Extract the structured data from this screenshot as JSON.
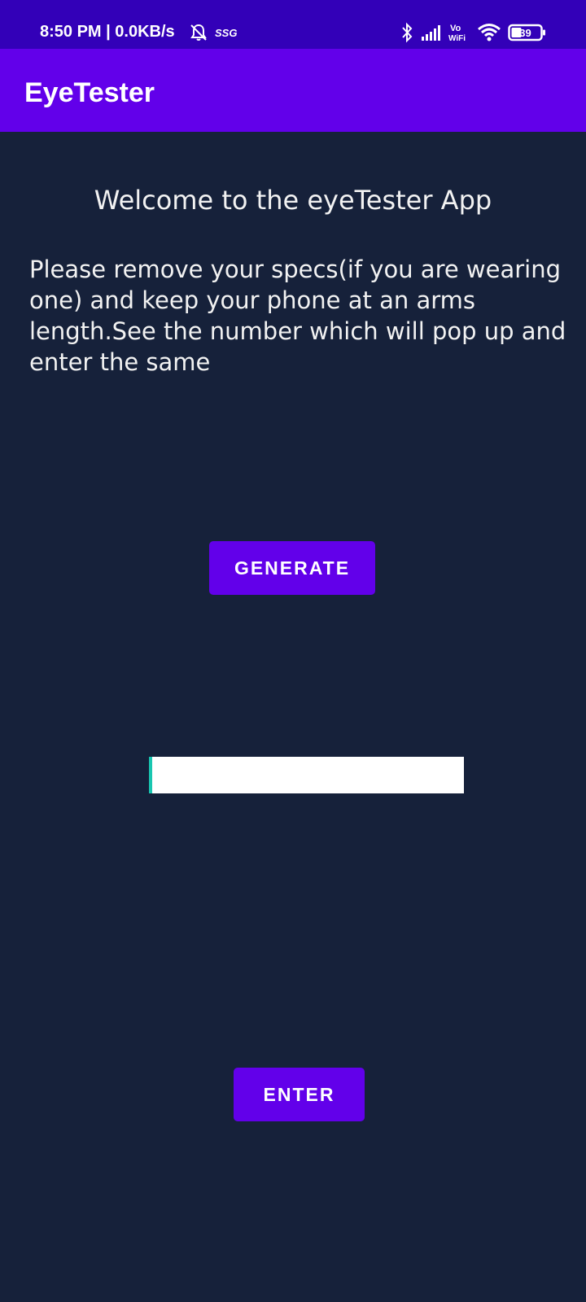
{
  "status_bar": {
    "time_and_speed": "8:50 PM | 0.0KB/s",
    "carrier_tag": "SSG",
    "vowifi_top": "Vo",
    "vowifi_bottom": "WiFi",
    "battery_level": "39",
    "icons": [
      "alarm-off-icon",
      "bluetooth-icon",
      "signal-icon",
      "vowifi-icon",
      "wifi-icon",
      "battery-icon"
    ],
    "background_color": "#3300b8"
  },
  "app_bar": {
    "title": "EyeTester",
    "background_color": "#6200ea"
  },
  "main": {
    "welcome_text": "Welcome to the eyeTester App",
    "instructions": "Please remove your specs(if you are wearing one) and keep your phone at an arms length.See the number which will pop up and enter the same",
    "generate_button_label": "GENERATE",
    "answer_input_value": "",
    "enter_button_label": "ENTER",
    "background_color": "#16213a",
    "accent_color": "#6200ea",
    "input_cursor_color": "#19c6b0"
  }
}
